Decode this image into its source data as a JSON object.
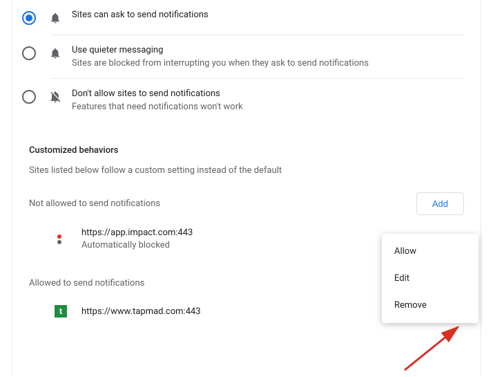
{
  "defaultBehavior": {
    "options": [
      {
        "title": "Sites can ask to send notifications",
        "sub": "",
        "icon": "bell",
        "selected": true
      },
      {
        "title": "Use quieter messaging",
        "sub": "Sites are blocked from interrupting you when they ask to send notifications",
        "icon": "bell",
        "selected": false
      },
      {
        "title": "Don't allow sites to send notifications",
        "sub": "Features that need notifications won't work",
        "icon": "bell-off",
        "selected": false
      }
    ]
  },
  "customized": {
    "title": "Customized behaviors",
    "description": "Sites listed below follow a custom setting instead of the default"
  },
  "blocked": {
    "label": "Not allowed to send notifications",
    "add_label": "Add",
    "site": {
      "url": "https://app.impact.com:443",
      "sub": "Automatically blocked"
    }
  },
  "allowed": {
    "label": "Allowed to send notifications",
    "site": {
      "url": "https://www.tapmad.com:443",
      "favicon_letter": "t"
    }
  },
  "menu": {
    "allow": "Allow",
    "edit": "Edit",
    "remove": "Remove"
  }
}
